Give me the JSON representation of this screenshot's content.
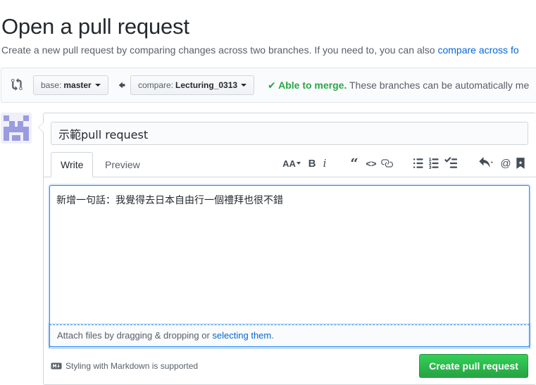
{
  "header": {
    "title": "Open a pull request",
    "description": "Create a new pull request by comparing changes across two branches. If you need to, you can also ",
    "description_link": "compare across fo"
  },
  "range": {
    "base_label": "base:",
    "base_value": "master",
    "compare_label": "compare:",
    "compare_value": "Lecturing_0313",
    "merge_ok": "✔ Able to merge.",
    "merge_text": " These branches can be automatically me"
  },
  "form": {
    "title_value": "示範pull request",
    "tabs": [
      {
        "label": "Write",
        "active": true
      },
      {
        "label": "Preview",
        "active": false
      }
    ],
    "body_value": "新增一句話：我覺得去日本自由行一個禮拜也很不錯",
    "attach_text": "Attach files by dragging & dropping or ",
    "attach_link": "selecting them",
    "attach_end": ".",
    "markdown_note": "Styling with Markdown is supported",
    "submit_label": "Create pull request"
  },
  "toolbar_icons": [
    "header-icon",
    "bold-icon",
    "italic-icon",
    "quote-icon",
    "code-icon",
    "link-icon",
    "unordered-list-icon",
    "ordered-list-icon",
    "task-list-icon",
    "reply-icon",
    "mention-icon",
    "bookmark-icon"
  ],
  "colors": {
    "link": "#0366d6",
    "success": "#28a745",
    "focus_border": "#2188ff"
  }
}
